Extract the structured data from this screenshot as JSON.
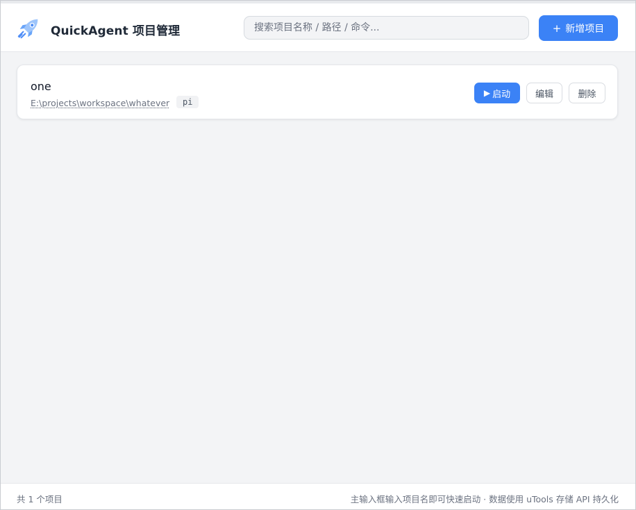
{
  "header": {
    "logo_icon": "rocket-icon",
    "title": "QuickAgent 项目管理",
    "search_placeholder": "搜索项目名称 / 路径 / 命令...",
    "add_button_label": "新增项目",
    "add_button_icon": "plus-icon"
  },
  "colors": {
    "accent": "#3b82f6",
    "background": "#f3f4f6",
    "logo_light": "#9ec5fb",
    "logo_dark": "#4f8ef7"
  },
  "projects": [
    {
      "name": "one",
      "path": "E:\\projects\\workspace\\whatever",
      "command": "pi",
      "run_label": "启动",
      "run_icon": "play-icon",
      "edit_label": "编辑",
      "delete_label": "删除"
    }
  ],
  "footer": {
    "count_text": "共 1 个项目",
    "hint_text": "主输入框输入项目名即可快速启动 · 数据使用 uTools 存储 API 持久化"
  }
}
